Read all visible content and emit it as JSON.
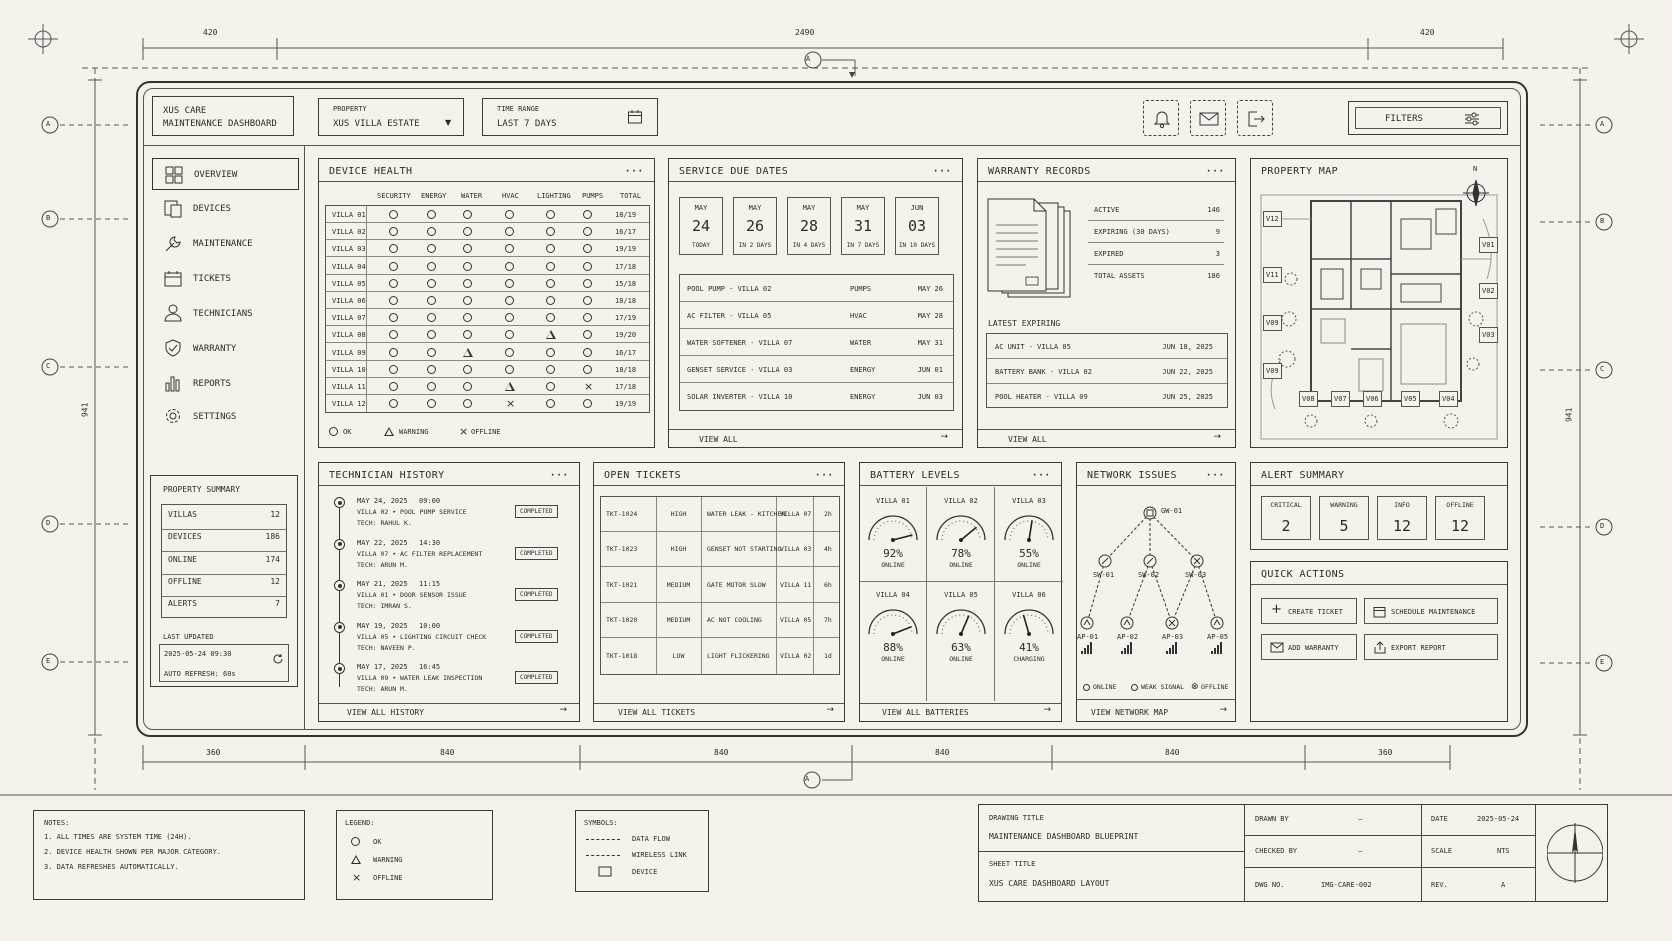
{
  "dimensions": {
    "top_center": "2490",
    "top_left": "420",
    "top_right": "420",
    "left_side": "941",
    "right_side": "941",
    "bottom": [
      "360",
      "840",
      "840",
      "840",
      "840",
      "360"
    ],
    "marker_a": "A",
    "grid_labels": [
      "A",
      "B",
      "C",
      "D",
      "E"
    ]
  },
  "header": {
    "app_title_line1": "XUS CARE",
    "app_title_line2": "MAINTENANCE DASHBOARD",
    "property_label": "PROPERTY",
    "property_value": "XUS VILLA ESTATE",
    "time_label": "TIME RANGE",
    "time_value": "LAST 7 DAYS",
    "filters_label": "FILTERS"
  },
  "sidebar": {
    "items": [
      {
        "label": "OVERVIEW",
        "icon": "grid-icon"
      },
      {
        "label": "DEVICES",
        "icon": "devices-icon"
      },
      {
        "label": "MAINTENANCE",
        "icon": "wrench-icon"
      },
      {
        "label": "TICKETS",
        "icon": "calendar-icon"
      },
      {
        "label": "TECHNICIANS",
        "icon": "user-icon"
      },
      {
        "label": "WARRANTY",
        "icon": "shield-icon"
      },
      {
        "label": "REPORTS",
        "icon": "bar-chart-icon"
      },
      {
        "label": "SETTINGS",
        "icon": "gear-icon"
      }
    ]
  },
  "property_summary": {
    "title": "PROPERTY SUMMARY",
    "rows": [
      {
        "label": "VILLAS",
        "value": "12"
      },
      {
        "label": "DEVICES",
        "value": "186"
      },
      {
        "label": "ONLINE",
        "value": "174"
      },
      {
        "label": "OFFLINE",
        "value": "12"
      },
      {
        "label": "ALERTS",
        "value": "7"
      }
    ],
    "updated_label": "LAST UPDATED",
    "updated_value": "2025-05-24 09:30",
    "auto_refresh": "AUTO REFRESH: 60s"
  },
  "device_health": {
    "title": "DEVICE HEALTH",
    "columns": [
      "SECURITY",
      "ENERGY",
      "WATER",
      "HVAC",
      "LIGHTING",
      "PUMPS",
      "TOTAL"
    ],
    "rows": [
      {
        "villa": "VILLA 01",
        "s": [
          "o",
          "o",
          "o",
          "o",
          "o",
          "o"
        ],
        "total": "18/19"
      },
      {
        "villa": "VILLA 02",
        "s": [
          "o",
          "o",
          "o",
          "o",
          "o",
          "o"
        ],
        "total": "16/17"
      },
      {
        "villa": "VILLA 03",
        "s": [
          "o",
          "o",
          "o",
          "o",
          "o",
          "o"
        ],
        "total": "19/19"
      },
      {
        "villa": "VILLA 04",
        "s": [
          "o",
          "o",
          "o",
          "o",
          "o",
          "o"
        ],
        "total": "17/18"
      },
      {
        "villa": "VILLA 05",
        "s": [
          "o",
          "o",
          "o",
          "o",
          "o",
          "o"
        ],
        "total": "15/18"
      },
      {
        "villa": "VILLA 06",
        "s": [
          "o",
          "o",
          "o",
          "o",
          "o",
          "o"
        ],
        "total": "18/18"
      },
      {
        "villa": "VILLA 07",
        "s": [
          "o",
          "o",
          "o",
          "o",
          "o",
          "o"
        ],
        "total": "17/19"
      },
      {
        "villa": "VILLA 08",
        "s": [
          "o",
          "o",
          "o",
          "o",
          "w",
          "o"
        ],
        "total": "19/20"
      },
      {
        "villa": "VILLA 09",
        "s": [
          "o",
          "o",
          "w",
          "o",
          "o",
          "o"
        ],
        "total": "16/17"
      },
      {
        "villa": "VILLA 10",
        "s": [
          "o",
          "o",
          "o",
          "o",
          "o",
          "o"
        ],
        "total": "18/18"
      },
      {
        "villa": "VILLA 11",
        "s": [
          "o",
          "o",
          "o",
          "w",
          "o",
          "x"
        ],
        "total": "17/18"
      },
      {
        "villa": "VILLA 12",
        "s": [
          "o",
          "o",
          "o",
          "x",
          "o",
          "o"
        ],
        "total": "19/19"
      }
    ],
    "legend": {
      "ok": "OK",
      "warning": "WARNING",
      "offline": "OFFLINE"
    }
  },
  "service_due": {
    "title": "SERVICE DUE DATES",
    "dates": [
      {
        "month": "MAY",
        "day": "24",
        "note": "TODAY"
      },
      {
        "month": "MAY",
        "day": "26",
        "note": "IN 2 DAYS"
      },
      {
        "month": "MAY",
        "day": "28",
        "note": "IN 4 DAYS"
      },
      {
        "month": "MAY",
        "day": "31",
        "note": "IN 7 DAYS"
      },
      {
        "month": "JUN",
        "day": "03",
        "note": "IN 10 DAYS"
      }
    ],
    "items": [
      {
        "name": "POOL PUMP - VILLA 02",
        "cat": "PUMPS",
        "date": "MAY 26"
      },
      {
        "name": "AC FILTER - VILLA 05",
        "cat": "HVAC",
        "date": "MAY 28"
      },
      {
        "name": "WATER SOFTENER - VILLA 07",
        "cat": "WATER",
        "date": "MAY 31"
      },
      {
        "name": "GENSET SERVICE - VILLA 03",
        "cat": "ENERGY",
        "date": "JUN 01"
      },
      {
        "name": "SOLAR INVERTER - VILLA 10",
        "cat": "ENERGY",
        "date": "JUN 03"
      }
    ],
    "view_all": "VIEW ALL"
  },
  "warranty": {
    "title": "WARRANTY RECORDS",
    "stats": [
      {
        "label": "ACTIVE",
        "value": "146"
      },
      {
        "label": "EXPIRING (30 DAYS)",
        "value": "9"
      },
      {
        "label": "EXPIRED",
        "value": "3"
      },
      {
        "label": "TOTAL ASSETS",
        "value": "186"
      }
    ],
    "latest_label": "LATEST EXPIRING",
    "latest": [
      {
        "name": "AC UNIT - VILLA 05",
        "date": "JUN 18, 2025"
      },
      {
        "name": "BATTERY BANK - VILLA 02",
        "date": "JUN 22, 2025"
      },
      {
        "name": "POOL HEATER - VILLA 09",
        "date": "JUN 25, 2025"
      }
    ],
    "view_all": "VIEW ALL"
  },
  "property_map": {
    "title": "PROPERTY MAP",
    "north": "N",
    "labels": [
      "V12",
      "V01",
      "V11",
      "V02",
      "V09",
      "V03",
      "V09",
      "V08",
      "V07",
      "V06",
      "V05",
      "V04"
    ]
  },
  "tech_history": {
    "title": "TECHNICIAN HISTORY",
    "entries": [
      {
        "date": "MAY 24, 2025",
        "time": "09:00",
        "desc": "VILLA 02  •  POOL PUMP SERVICE",
        "tech": "TECH: RAHUL K.",
        "status": "COMPLETED"
      },
      {
        "date": "MAY 22, 2025",
        "time": "14:30",
        "desc": "VILLA 07  •  AC FILTER REPLACEMENT",
        "tech": "TECH: ARUN M.",
        "status": "COMPLETED"
      },
      {
        "date": "MAY 21, 2025",
        "time": "11:15",
        "desc": "VILLA 01  •  DOOR SENSOR ISSUE",
        "tech": "TECH: IMRAN S.",
        "status": "COMPLETED"
      },
      {
        "date": "MAY 19, 2025",
        "time": "10:00",
        "desc": "VILLA 05  •  LIGHTING CIRCUIT CHECK",
        "tech": "TECH: NAVEEN P.",
        "status": "COMPLETED"
      },
      {
        "date": "MAY 17, 2025",
        "time": "16:45",
        "desc": "VILLA 09  •  WATER LEAK INSPECTION",
        "tech": "TECH: ARUN M.",
        "status": "COMPLETED"
      }
    ],
    "view_all": "VIEW ALL HISTORY"
  },
  "tickets": {
    "title": "OPEN TICKETS",
    "rows": [
      {
        "id": "TKT-1024",
        "priority": "HIGH",
        "issue": "WATER LEAK - KITCHEN",
        "villa": "VILLA 07",
        "age": "2h"
      },
      {
        "id": "TKT-1023",
        "priority": "HIGH",
        "issue": "GENSET NOT STARTING",
        "villa": "VILLA 03",
        "age": "4h"
      },
      {
        "id": "TKT-1021",
        "priority": "MEDIUM",
        "issue": "GATE MOTOR SLOW",
        "villa": "VILLA 11",
        "age": "6h"
      },
      {
        "id": "TKT-1020",
        "priority": "MEDIUM",
        "issue": "AC NOT COOLING",
        "villa": "VILLA 05",
        "age": "7h"
      },
      {
        "id": "TKT-1018",
        "priority": "LOW",
        "issue": "LIGHT FLICKERING",
        "villa": "VILLA 02",
        "age": "1d"
      }
    ],
    "view_all": "VIEW ALL TICKETS"
  },
  "battery": {
    "title": "BATTERY LEVELS",
    "items": [
      {
        "villa": "VILLA 01",
        "pct": "92%",
        "value": 0.92,
        "status": "ONLINE"
      },
      {
        "villa": "VILLA 02",
        "pct": "78%",
        "value": 0.78,
        "status": "ONLINE"
      },
      {
        "villa": "VILLA 03",
        "pct": "55%",
        "value": 0.55,
        "status": "ONLINE"
      },
      {
        "villa": "VILLA 04",
        "pct": "88%",
        "value": 0.88,
        "status": "ONLINE"
      },
      {
        "villa": "VILLA 05",
        "pct": "63%",
        "value": 0.63,
        "status": "ONLINE"
      },
      {
        "villa": "VILLA 06",
        "pct": "41%",
        "value": 0.41,
        "status": "CHARGING"
      }
    ],
    "view_all": "VIEW ALL BATTERIES"
  },
  "network": {
    "title": "NETWORK ISSUES",
    "gw": "GW-01",
    "switches": [
      "SW-01",
      "SW-02",
      "SW-03"
    ],
    "aps": [
      "AP-01",
      "AP-02",
      "AP-03",
      "AP-05"
    ],
    "legend": {
      "online": "ONLINE",
      "weak": "WEAK SIGNAL",
      "offline": "OFFLINE"
    },
    "view_all": "VIEW NETWORK MAP"
  },
  "alerts": {
    "title": "ALERT SUMMARY",
    "items": [
      {
        "label": "CRITICAL",
        "value": "2"
      },
      {
        "label": "WARNING",
        "value": "5"
      },
      {
        "label": "INFO",
        "value": "12"
      },
      {
        "label": "OFFLINE",
        "value": "12"
      }
    ]
  },
  "quick_actions": {
    "title": "QUICK ACTIONS",
    "buttons": [
      {
        "label": "CREATE TICKET",
        "icon": "plus-icon"
      },
      {
        "label": "SCHEDULE MAINTENANCE",
        "icon": "calendar-icon"
      },
      {
        "label": "ADD WARRANTY",
        "icon": "mail-icon"
      },
      {
        "label": "EXPORT REPORT",
        "icon": "export-icon"
      }
    ]
  },
  "footer": {
    "notes_title": "NOTES:",
    "notes": [
      "1. ALL TIMES ARE SYSTEM TIME (24H).",
      "2. DEVICE HEALTH SHOWN PER MAJOR CATEGORY.",
      "3. DATA REFRESHES AUTOMATICALLY."
    ],
    "legend_title": "LEGEND:",
    "legend": [
      "OK",
      "WARNING",
      "OFFLINE"
    ],
    "symbols_title": "SYMBOLS:",
    "symbols": [
      "DATA FLOW",
      "WIRELESS LINK",
      "DEVICE"
    ],
    "drawing_title_label": "DRAWING TITLE",
    "drawing_title": "MAINTENANCE DASHBOARD BLUEPRINT",
    "sheet_title_label": "SHEET TITLE",
    "sheet_title": "XUS CARE DASHBOARD LAYOUT",
    "drawn_by_label": "DRAWN BY",
    "drawn_by": "—",
    "checked_by_label": "CHECKED BY",
    "checked_by": "—",
    "dwg_no_label": "DWG NO.",
    "dwg_no": "IMG-CARE-002",
    "date_label": "DATE",
    "date": "2025-05-24",
    "scale_label": "SCALE",
    "scale": "NTS",
    "rev_label": "REV.",
    "rev": "A"
  }
}
